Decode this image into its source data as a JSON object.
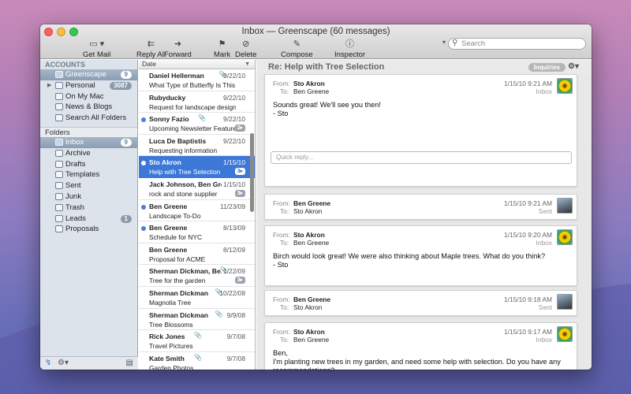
{
  "window": {
    "title": "Inbox — Greenscape (60 messages)"
  },
  "toolbar": {
    "get_mail": "Get Mail",
    "reply_all": "Reply All",
    "forward": "Forward",
    "mark": "Mark",
    "delete": "Delete",
    "compose": "Compose",
    "inspector": "Inspector",
    "search_placeholder": "Search"
  },
  "sidebar": {
    "accounts_header": "ACCOUNTS",
    "accounts": [
      {
        "label": "Greenscape",
        "badge": "9",
        "selected": true
      },
      {
        "label": "Personal",
        "badge": "3087"
      },
      {
        "label": "On My Mac"
      },
      {
        "label": "News & Blogs"
      },
      {
        "label": "Search All Folders"
      }
    ],
    "folders_header": "Folders",
    "folders": [
      {
        "label": "Inbox",
        "badge": "9",
        "selected": true
      },
      {
        "label": "Archive"
      },
      {
        "label": "Drafts"
      },
      {
        "label": "Templates"
      },
      {
        "label": "Sent"
      },
      {
        "label": "Junk"
      },
      {
        "label": "Trash"
      },
      {
        "label": "Leads",
        "badge": "1"
      },
      {
        "label": "Proposals"
      }
    ]
  },
  "list": {
    "column_header": "Date",
    "messages": [
      {
        "from": "Daniel Hellerman",
        "date": "9/22/10",
        "subject": "What Type of Butterfly Is This On M...",
        "attachment": true
      },
      {
        "from": "Rubyducky",
        "date": "9/22/10",
        "subject": "Request for landscape design"
      },
      {
        "from": "Sonny Fazio",
        "date": "9/22/10",
        "subject": "Upcoming Newsletter Feature I...",
        "unread": true,
        "attachment": true,
        "thread": "2"
      },
      {
        "from": "Luca De Baptistis",
        "date": "9/22/10",
        "subject": "Requesting information"
      },
      {
        "from": "Sto Akron",
        "date": "1/15/10",
        "subject": "Help with Tree Selection",
        "unread": true,
        "selected": true,
        "thread": "3"
      },
      {
        "from": "Jack Johnson, Ben Greene",
        "date": "1/15/10",
        "subject": "rock and stone supplier",
        "thread": "3"
      },
      {
        "from": "Ben Greene",
        "date": "11/23/09",
        "subject": "Landscape To-Do",
        "unread": true
      },
      {
        "from": "Ben Greene",
        "date": "8/13/09",
        "subject": "Schedule for NYC",
        "unread": true
      },
      {
        "from": "Ben Greene",
        "date": "8/12/09",
        "subject": "Proposal for ACME"
      },
      {
        "from": "Sherman Dickman, Be...",
        "date": "1/22/09",
        "subject": "Tree for the garden",
        "attachment": true,
        "thread": "3"
      },
      {
        "from": "Sherman Dickman",
        "date": "10/22/08",
        "subject": "Magnolia Tree",
        "attachment": true
      },
      {
        "from": "Sherman Dickman",
        "date": "9/9/08",
        "subject": "Tree Blossoms",
        "attachment": true
      },
      {
        "from": "Rick Jones",
        "date": "9/7/08",
        "subject": "Travel Pictures",
        "attachment": true
      },
      {
        "from": "Kate Smith",
        "date": "9/7/08",
        "subject": "Garden Photos",
        "attachment": true
      }
    ]
  },
  "pane": {
    "subject": "Re: Help with Tree Selection",
    "tag": "Inquiries",
    "from_label": "From:",
    "to_label": "To:",
    "quick_reply_placeholder": "Quick reply...",
    "messages": [
      {
        "from": "Sto Akron",
        "to": "Ben Greene",
        "date": "1/15/10 9:21 AM",
        "mailbox": "Inbox",
        "avatar": "flower-avatar",
        "body": "Sounds great!  We'll see you then!\n- Sto"
      },
      {
        "from": "Ben Greene",
        "to": "Sto Akron",
        "date": "1/15/10 9:21 AM",
        "mailbox": "Sent",
        "avatar": "person-avatar",
        "body": ""
      },
      {
        "from": "Sto Akron",
        "to": "Ben Greene",
        "date": "1/15/10 9:20 AM",
        "mailbox": "Inbox",
        "avatar": "flower-avatar",
        "body": "Birch would look great!  We were also thinking about Maple trees.  What do you think?\n- Sto"
      },
      {
        "from": "Ben Greene",
        "to": "Sto Akron",
        "date": "1/15/10 9:18 AM",
        "mailbox": "Sent",
        "avatar": "person-avatar",
        "body": ""
      },
      {
        "from": "Sto Akron",
        "to": "Ben Greene",
        "date": "1/15/10 9:17 AM",
        "mailbox": "Inbox",
        "avatar": "flower-avatar",
        "body": "Ben,\nI'm planting new trees in my garden, and need some help with selection.  Do you have any recommendations?\n- Sto Akron"
      }
    ]
  }
}
